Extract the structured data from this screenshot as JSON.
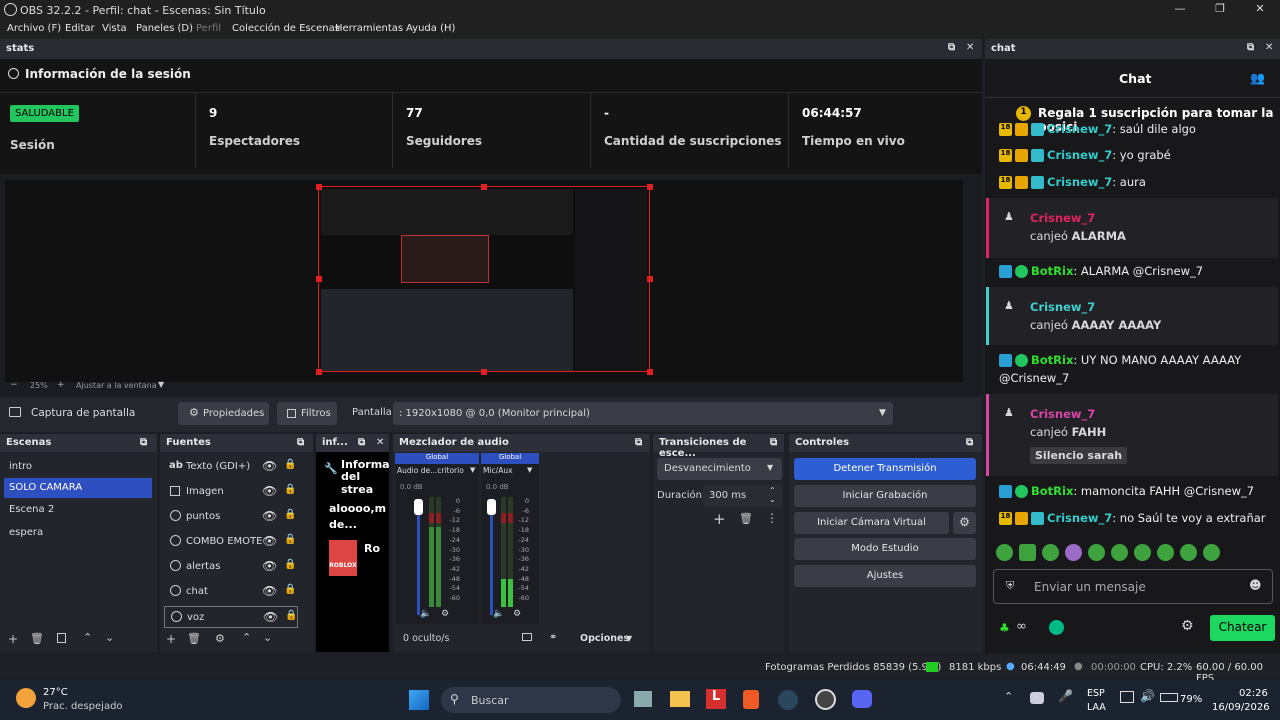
{
  "window": {
    "title": "OBS 32.2.2 - Perfil: chat - Escenas: Sin Título"
  },
  "menu": [
    "Archivo (F)",
    "Editar",
    "Vista",
    "Paneles (D)",
    "Perfil",
    "Colección de Escenas",
    "Herramientas",
    "Ayuda (H)"
  ],
  "stats": {
    "dock_title": "stats",
    "header": "Información de la sesión",
    "health": "SALUDABLE",
    "health_label": "Sesión",
    "viewers": "9",
    "viewers_label": "Espectadores",
    "followers": "77",
    "followers_label": "Seguidores",
    "subs": "-",
    "subs_label": "Cantidad de suscripciones",
    "time": "06:44:57",
    "time_label": "Tiempo en vivo"
  },
  "preview": {
    "zoom": "25%",
    "fit": "Ajustar a la ventana"
  },
  "source_bar": {
    "source": "Captura de pantalla",
    "props": "Propiedades",
    "filters": "Filtros",
    "display_label": "Pantalla",
    "display_value": ": 1920x1080 @ 0,0 (Monitor principal)"
  },
  "scenes": {
    "title": "Escenas",
    "items": [
      "intro",
      "SOLO CAMARA",
      "Escena 2",
      "espera"
    ],
    "selected": 1
  },
  "sources": {
    "title": "Fuentes",
    "items": [
      "Texto (GDI+)",
      "Imagen",
      "puntos",
      "COMBO EMOTE",
      "alertas",
      "chat",
      "voz"
    ]
  },
  "info": {
    "title": "inf...",
    "text1": "Informa",
    "text2": "del strea",
    "msg1": "aloooo,m",
    "msg2": "de...",
    "app": "Ro",
    "roblox": "ROBLOX"
  },
  "mixer": {
    "title": "Mezclador de audio",
    "ch1": {
      "tag": "Global",
      "name": "Audio de...critorio",
      "db": "0.0 dB"
    },
    "ch2": {
      "tag": "Global",
      "name": "Mic/Aux",
      "db": "0.0 dB"
    },
    "scale": [
      "0",
      "-6",
      "-12",
      "-18",
      "-24",
      "-30",
      "-36",
      "-42",
      "-48",
      "-54",
      "-60"
    ],
    "hidden": "0 oculto/s",
    "options": "Opciones"
  },
  "transitions": {
    "title": "Transiciones de esce...",
    "type": "Desvanecimiento",
    "duration_label": "Duración",
    "duration": "300 ms"
  },
  "controls": {
    "title": "Controles",
    "stop_stream": "Detener Transmisión",
    "start_rec": "Iniciar Grabación",
    "start_vcam": "Iniciar Cámara Virtual",
    "studio": "Modo Estudio",
    "settings": "Ajustes"
  },
  "statusbar": {
    "dropped": "Fotogramas Perdidos 85839 (5.9%)",
    "kbps": "8181 kbps",
    "live": "06:44:49",
    "rec": "00:00:00",
    "cpu": "CPU: 2.2%",
    "fps": "60.00 / 60.00 FPS"
  },
  "chat": {
    "dock_title": "chat",
    "title": "Chat",
    "pinned": "Regala 1 suscripción para tomar la posici",
    "lines": [
      {
        "user": "Crisnew_7",
        "text": ": saúl dile algo"
      },
      {
        "user": "Crisnew_7",
        "text": ": yo grabé"
      },
      {
        "user": "Crisnew_7",
        "text": ": aura"
      }
    ],
    "redeem1": {
      "user": "Crisnew_7",
      "action": "canjeó",
      "reward": "ALARMA"
    },
    "bot1": {
      "user": "BotRix",
      "text": ": ALARMA @Crisnew_7"
    },
    "redeem2": {
      "user": "Crisnew_7",
      "action": "canjeó",
      "reward": "AAAAY AAAAY"
    },
    "bot2": {
      "user": "BotRix",
      "text": ": UY NO MANO AAAAY AAAAY",
      "text2": "@Crisnew_7"
    },
    "redeem3": {
      "user": "Crisnew_7",
      "action": "canjeó",
      "reward": "FAHH",
      "note": "Silencio sarah"
    },
    "bot3": {
      "user": "BotRix",
      "text": ": mamoncita FAHH @Crisnew_7"
    },
    "last": {
      "user": "Crisnew_7",
      "text": ": no Saúl te voy a extrañar"
    },
    "placeholder": "Enviar un mensaje",
    "send": "Chatear",
    "badge_num": "18"
  },
  "taskbar": {
    "weather_temp": "27°C",
    "weather_desc": "Prac. despejado",
    "search": "Buscar",
    "lang1": "ESP",
    "lang2": "LAA",
    "battery": "79%",
    "time": "02:26",
    "date": "16/09/2026"
  },
  "colors": {
    "accent": "#2e4fbf",
    "health": "#22c55e",
    "twitch_green": "#00ad03",
    "chatbtn": "#1ed760"
  }
}
